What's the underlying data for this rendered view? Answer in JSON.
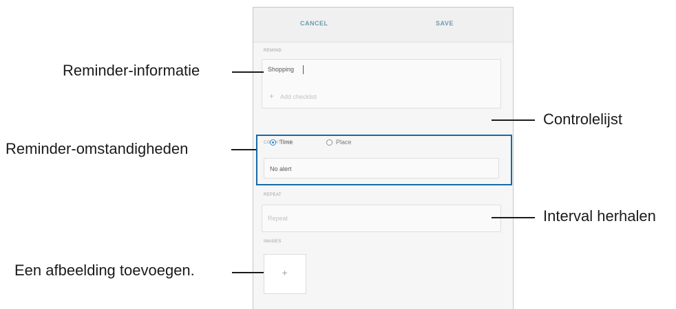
{
  "screen": {
    "header": {
      "cancel_label": "CANCEL",
      "save_label": "SAVE"
    },
    "reminder": {
      "section_label": "REMIND",
      "text_value": "Shopping",
      "checklist_label": "Add checklist"
    },
    "condition": {
      "section_label": "CONDITIONS",
      "options": [
        {
          "label": "Time",
          "selected": true
        },
        {
          "label": "Place",
          "selected": false
        }
      ],
      "alert_value": "No alert"
    },
    "repeat": {
      "section_label": "REPEAT",
      "value": "Repeat"
    },
    "images": {
      "section_label": "IMAGES",
      "add_symbol": "+"
    }
  },
  "callouts": {
    "reminder_info": "Reminder-informatie",
    "checklist": "Controlelijst",
    "conditions": "Reminder-omstandigheden",
    "repeat_interval": "Interval herhalen",
    "add_image": "Een afbeelding toevoegen."
  },
  "colors": {
    "highlight": "#1668a8",
    "accent": "#2a84c8"
  }
}
